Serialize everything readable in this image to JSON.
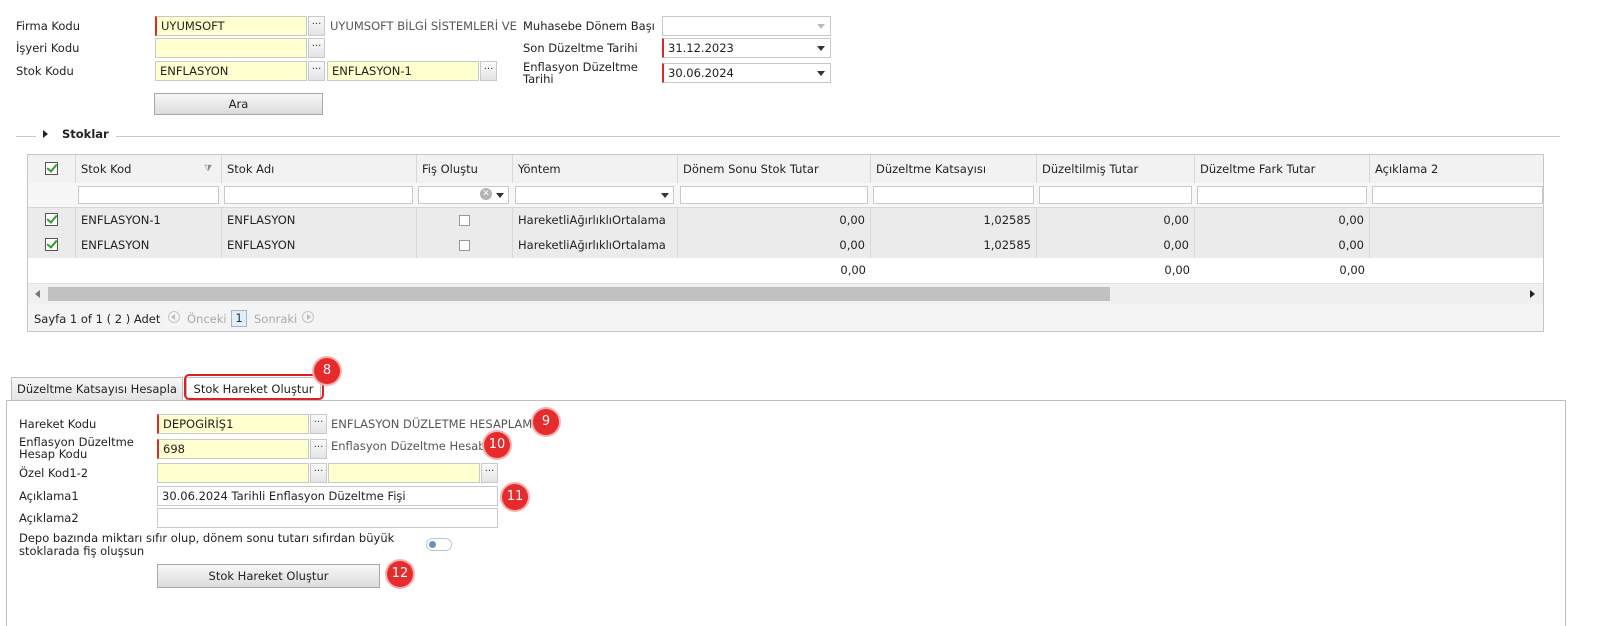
{
  "filters": {
    "firma_kodu": {
      "label": "Firma Kodu",
      "value": "UYUMSOFT",
      "desc": "UYUMSOFT BİLGİ SİSTEMLERİ VE T"
    },
    "isyeri_kodu": {
      "label": "İşyeri Kodu",
      "value": ""
    },
    "stok_kodu": {
      "label": "Stok Kodu",
      "value1": "ENFLASYON",
      "value2": "ENFLASYON-1"
    },
    "muhasebe_donem_basi": {
      "label": "Muhasebe Dönem Başı",
      "value": ""
    },
    "son_duzeltme_tarihi": {
      "label": "Son Düzeltme Tarihi",
      "value": "31.12.2023"
    },
    "enflasyon_duzeltme_tarihi": {
      "label_line1": "Enflasyon Düzeltme",
      "label_line2": "Tarihi",
      "value": "30.06.2024"
    },
    "search_button": "Ara",
    "dots": "···"
  },
  "section": {
    "title": "Stoklar"
  },
  "grid": {
    "columns": [
      "Stok Kod",
      "Stok Adı",
      "Fiş Oluştu",
      "Yöntem",
      "Dönem Sonu Stok Tutar",
      "Düzeltme Katsayısı",
      "Düzeltilmiş Tutar",
      "Düzeltme Fark Tutar",
      "Açıklama 2"
    ],
    "rows": [
      {
        "checked": true,
        "stok_kod": "ENFLASYON-1",
        "stok_adi": "ENFLASYON",
        "fis_olustu": false,
        "yontem": "HareketliAğırlıklıOrtalama",
        "donem_sonu": "0,00",
        "katsayi": "1,02585",
        "duzeltilmis": "0,00",
        "fark": "0,00",
        "aciklama2": ""
      },
      {
        "checked": true,
        "stok_kod": "ENFLASYON",
        "stok_adi": "ENFLASYON",
        "fis_olustu": false,
        "yontem": "HareketliAğırlıklıOrtalama",
        "donem_sonu": "0,00",
        "katsayi": "1,02585",
        "duzeltilmis": "0,00",
        "fark": "0,00",
        "aciklama2": ""
      }
    ],
    "totals": {
      "donem_sonu": "0,00",
      "duzeltilmis": "0,00",
      "fark": "0,00"
    },
    "pager": {
      "info": "Sayfa 1 of 1 ( 2 ) Adet",
      "prev": "Önceki",
      "page": "1",
      "next": "Sonraki"
    }
  },
  "tabs": [
    {
      "label": "Düzeltme Katsayısı Hesapla",
      "active": false
    },
    {
      "label": "Stok Hareket Oluştur",
      "active": true
    }
  ],
  "form": {
    "hareket_kodu": {
      "label": "Hareket Kodu",
      "value": "DEPOGİRİŞ1",
      "desc": "ENFLASYON DÜZLETME HESAPLAM"
    },
    "hesap_kodu": {
      "label_line1": "Enflasyon Düzeltme",
      "label_line2": "Hesap Kodu",
      "value": "698",
      "desc": "Enflasyon Düzeltme Hesabı"
    },
    "ozel_kod": {
      "label": "Özel Kod1-2",
      "value1": "",
      "value2": ""
    },
    "aciklama1": {
      "label": "Açıklama1",
      "value": "30.06.2024 Tarihli Enflasyon Düzeltme Fişi"
    },
    "aciklama2": {
      "label": "Açıklama2",
      "value": ""
    },
    "depo_toggle": {
      "label_line1": "Depo bazında miktarı sıfır olup, dönem sonu tutarı sıfırdan büyük",
      "label_line2": "stoklarada fiş oluşsun",
      "on": false
    },
    "submit_button": "Stok Hareket Oluştur"
  },
  "badges": [
    "8",
    "9",
    "10",
    "11",
    "12"
  ],
  "colors": {
    "required_border": "#d52b2b",
    "input_yellow": "#ffffd0",
    "badge_red": "#e52b2b",
    "highlight_red": "#e02020",
    "check_green": "#2e9d2e"
  }
}
